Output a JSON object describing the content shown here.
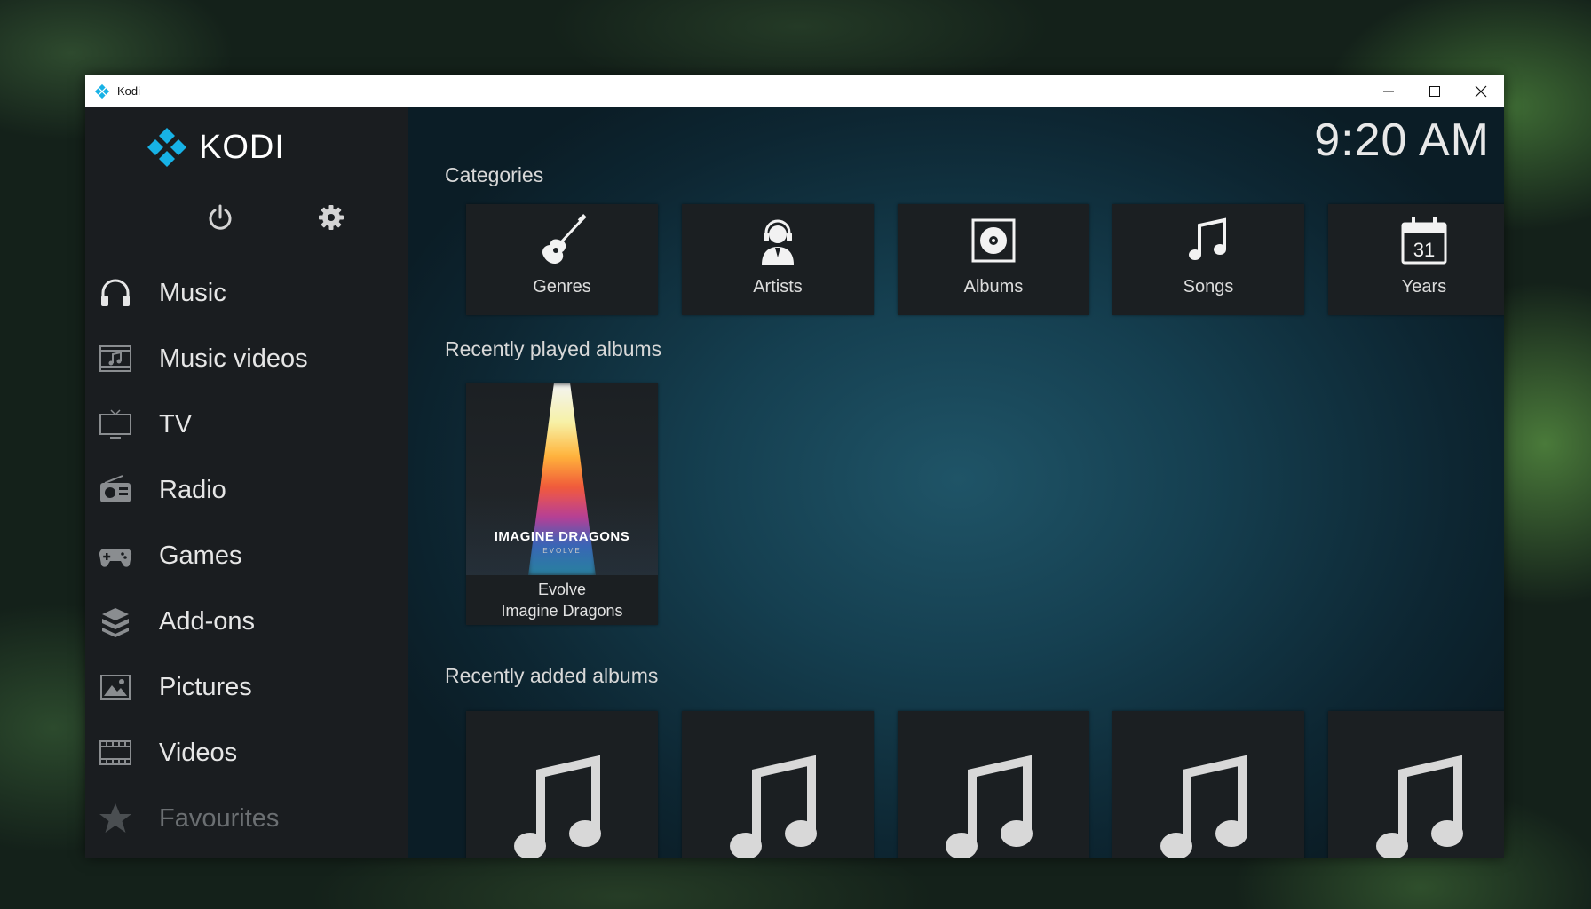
{
  "window": {
    "title": "Kodi"
  },
  "brand": {
    "name": "KODI"
  },
  "clock": "9:20 AM",
  "quick_actions": [
    {
      "name": "power-icon",
      "icon": "power-icon"
    },
    {
      "name": "settings-icon",
      "icon": "gear-icon"
    },
    {
      "name": "search-icon",
      "icon": "search-icon"
    }
  ],
  "menu": [
    {
      "label": "Music",
      "icon": "headphones-icon"
    },
    {
      "label": "Music videos",
      "icon": "music-video-icon"
    },
    {
      "label": "TV",
      "icon": "tv-icon"
    },
    {
      "label": "Radio",
      "icon": "radio-icon"
    },
    {
      "label": "Games",
      "icon": "gamepad-icon"
    },
    {
      "label": "Add-ons",
      "icon": "addons-icon"
    },
    {
      "label": "Pictures",
      "icon": "picture-icon"
    },
    {
      "label": "Videos",
      "icon": "film-icon"
    },
    {
      "label": "Favourites",
      "icon": "star-icon"
    }
  ],
  "sections": {
    "categories": "Categories",
    "recently_played": "Recently played albums",
    "recently_added": "Recently added albums"
  },
  "categories": [
    {
      "label": "Genres",
      "icon": "guitar-icon"
    },
    {
      "label": "Artists",
      "icon": "artist-icon"
    },
    {
      "label": "Albums",
      "icon": "album-icon"
    },
    {
      "label": "Songs",
      "icon": "music-note-icon"
    },
    {
      "label": "Years",
      "icon": "calendar-icon",
      "icon_text": "31"
    }
  ],
  "recently_played": [
    {
      "title": "Evolve",
      "artist": "Imagine Dragons",
      "art_band": "IMAGINE DRAGONS",
      "art_subtitle": "EVOLVE"
    }
  ],
  "recently_added_count_visible": 5,
  "colors": {
    "accent": "#17b2e6",
    "sidebar_bg": "#1a1d20",
    "tile_bg": "#1b1f22"
  }
}
